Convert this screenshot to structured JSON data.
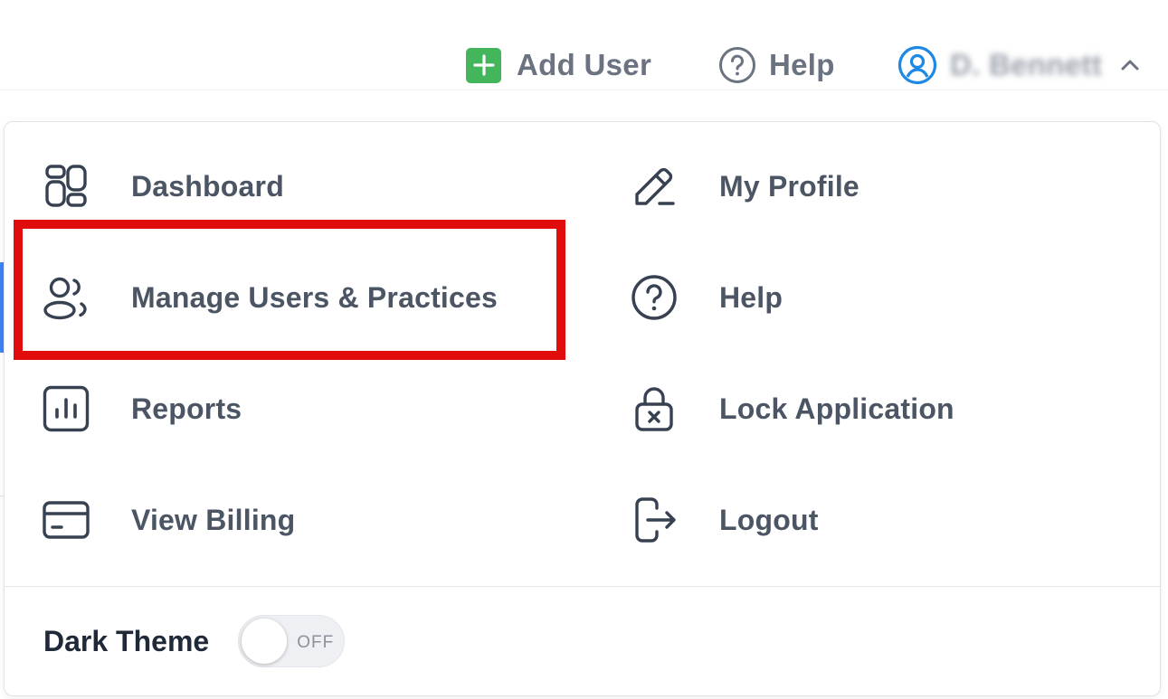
{
  "topbar": {
    "add_user_label": "Add User",
    "help_label": "Help",
    "user_name": "D. Bennett",
    "add_icon": "plus-square-icon",
    "help_icon": "question-circle-icon",
    "user_icon": "user-circle-icon",
    "chevron_icon": "chevron-up-icon"
  },
  "menu": {
    "left": [
      {
        "label": "Dashboard",
        "icon": "dashboard-icon"
      },
      {
        "label": "Manage Users & Practices",
        "icon": "users-icon"
      },
      {
        "label": "Reports",
        "icon": "bar-chart-icon"
      },
      {
        "label": "View Billing",
        "icon": "credit-card-icon"
      }
    ],
    "right": [
      {
        "label": "My Profile",
        "icon": "pencil-icon"
      },
      {
        "label": "Help",
        "icon": "question-circle-icon"
      },
      {
        "label": "Lock Application",
        "icon": "lock-icon"
      },
      {
        "label": "Logout",
        "icon": "logout-icon"
      }
    ]
  },
  "dark_theme": {
    "label": "Dark Theme",
    "state": "OFF",
    "enabled": false
  },
  "colors": {
    "accent_green": "#43b55a",
    "accent_blue": "#1e88e5",
    "highlight_red": "#e10d0d",
    "text": "#4b5563"
  }
}
